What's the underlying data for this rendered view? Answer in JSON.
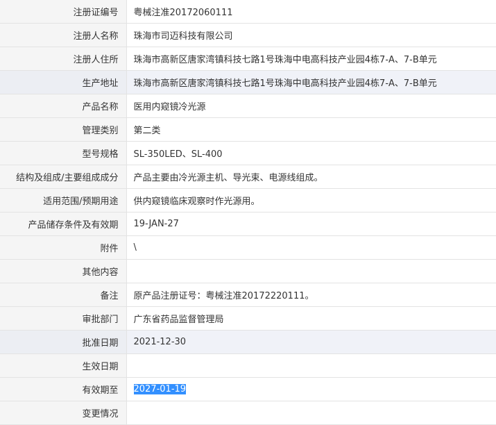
{
  "rows": [
    {
      "label": "注册证编号",
      "value": "粤械注准20172060111"
    },
    {
      "label": "注册人名称",
      "value": "珠海市司迈科技有限公司"
    },
    {
      "label": "注册人住所",
      "value": "珠海市高新区唐家湾镇科技七路1号珠海中电高科技产业园4栋7-A、7-B单元"
    },
    {
      "label": "生产地址",
      "value": "珠海市高新区唐家湾镇科技七路1号珠海中电高科技产业园4栋7-A、7-B单元"
    },
    {
      "label": "产品名称",
      "value": "医用内窥镜冷光源"
    },
    {
      "label": "管理类别",
      "value": "第二类"
    },
    {
      "label": "型号规格",
      "value": "SL-350LED、SL-400"
    },
    {
      "label": "结构及组成/主要组成成分",
      "value": "产品主要由冷光源主机、导光束、电源线组成。"
    },
    {
      "label": "适用范围/预期用途",
      "value": "供内窥镜临床观察时作光源用。"
    },
    {
      "label": "产品储存条件及有效期",
      "value": "19-JAN-27"
    },
    {
      "label": "附件",
      "value": "\\"
    },
    {
      "label": "其他内容",
      "value": ""
    },
    {
      "label": "备注",
      "value": "原产品注册证号：粤械注准20172220111。"
    },
    {
      "label": "审批部门",
      "value": "广东省药品监督管理局"
    },
    {
      "label": "批准日期",
      "value": "2021-12-30"
    },
    {
      "label": "生效日期",
      "value": ""
    },
    {
      "label": "有效期至",
      "value": "2027-01-19"
    },
    {
      "label": "变更情况",
      "value": ""
    }
  ],
  "colors": {
    "label_bg": "#f5f5f5",
    "border": "#e3e3e3",
    "hover_row_bg": "#f0f2f8",
    "selection_bg": "#3390ff",
    "text": "#333333"
  }
}
